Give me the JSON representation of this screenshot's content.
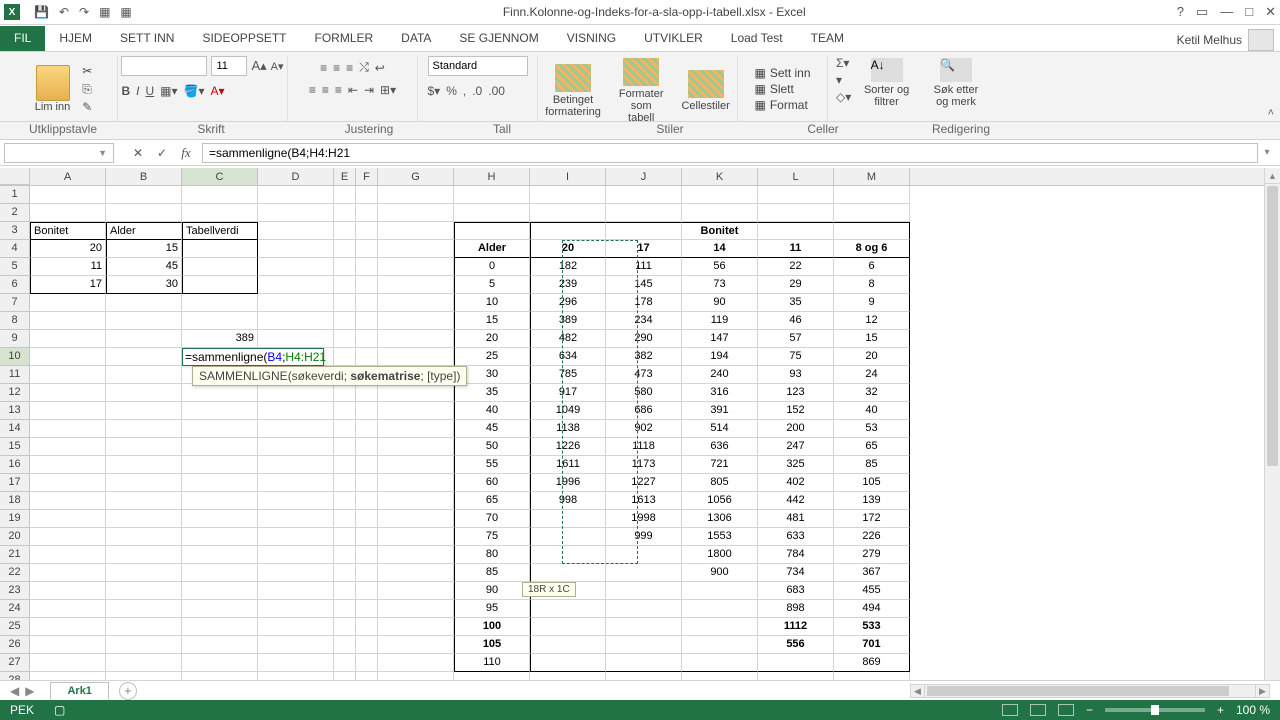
{
  "title": "Finn.Kolonne-og-Indeks-for-a-sla-opp-i-tabell.xlsx - Excel",
  "user": "Ketil Melhus",
  "tabs": [
    "FIL",
    "HJEM",
    "SETT INN",
    "SIDEOPPSETT",
    "FORMLER",
    "DATA",
    "SE GJENNOM",
    "VISNING",
    "UTVIKLER",
    "Load Test",
    "TEAM"
  ],
  "active_tab_index": 0,
  "ribbon": {
    "clipboard": {
      "label": "Utklippstavle",
      "paste": "Lim inn"
    },
    "font": {
      "label": "Skrift",
      "name": "",
      "size": "11"
    },
    "align": {
      "label": "Justering"
    },
    "number": {
      "label": "Tall",
      "format": "Standard"
    },
    "styles": {
      "label": "Stiler",
      "cond": "Betinget formatering",
      "table": "Formater som tabell",
      "cell": "Cellestiler"
    },
    "cells": {
      "label": "Celler",
      "insert": "Sett inn",
      "delete": "Slett",
      "format": "Format"
    },
    "editing": {
      "label": "Redigering",
      "sort": "Sorter og filtrer",
      "find": "Søk etter og merk"
    }
  },
  "name_box": "",
  "formula": "=sammenligne(B4;H4:H21",
  "cols": [
    "A",
    "B",
    "C",
    "D",
    "E",
    "F",
    "G",
    "H",
    "I",
    "J",
    "K",
    "L",
    "M"
  ],
  "left_table": {
    "h": [
      "Bonitet",
      "Alder",
      "Tabellverdi"
    ],
    "rows": [
      [
        "20",
        "15",
        ""
      ],
      [
        "11",
        "45",
        ""
      ],
      [
        "17",
        "30",
        ""
      ]
    ]
  },
  "c9": "389",
  "edit_text": {
    "fn": "=sammenligne(",
    "a1": "B4",
    "sep": ";",
    "a2": "H4:H21"
  },
  "tooltip": {
    "fn": "SAMMENLIGNE",
    "sig": "(søkeverdi; ",
    "cur": "søkematrise",
    "rest": "; [type])"
  },
  "size_tip": "18R x 1C",
  "bonitet_header": "Bonitet",
  "alder_header": "Alder",
  "bonitet_cols": [
    "20",
    "17",
    "14",
    "11",
    "8 og 6"
  ],
  "data_rows": [
    [
      "0",
      "182",
      "111",
      "56",
      "22",
      "6"
    ],
    [
      "5",
      "239",
      "145",
      "73",
      "29",
      "8"
    ],
    [
      "10",
      "296",
      "178",
      "90",
      "35",
      "9"
    ],
    [
      "15",
      "389",
      "234",
      "119",
      "46",
      "12"
    ],
    [
      "20",
      "482",
      "290",
      "147",
      "57",
      "15"
    ],
    [
      "25",
      "634",
      "382",
      "194",
      "75",
      "20"
    ],
    [
      "30",
      "785",
      "473",
      "240",
      "93",
      "24"
    ],
    [
      "35",
      "917",
      "580",
      "316",
      "123",
      "32"
    ],
    [
      "40",
      "1049",
      "686",
      "391",
      "152",
      "40"
    ],
    [
      "45",
      "1138",
      "902",
      "514",
      "200",
      "53"
    ],
    [
      "50",
      "1226",
      "1118",
      "636",
      "247",
      "65"
    ],
    [
      "55",
      "1611",
      "1173",
      "721",
      "325",
      "85"
    ],
    [
      "60",
      "1996",
      "1227",
      "805",
      "402",
      "105"
    ],
    [
      "65",
      "998",
      "1613",
      "1056",
      "442",
      "139"
    ],
    [
      "70",
      "",
      "1998",
      "1306",
      "481",
      "172"
    ],
    [
      "75",
      "",
      "999",
      "1553",
      "633",
      "226"
    ],
    [
      "80",
      "",
      "",
      "1800",
      "784",
      "279"
    ],
    [
      "85",
      "",
      "",
      "900",
      "734",
      "367"
    ],
    [
      "90",
      "",
      "",
      "",
      "683",
      "455"
    ],
    [
      "95",
      "",
      "",
      "",
      "898",
      "494"
    ],
    [
      "100",
      "",
      "",
      "",
      "1112",
      "533"
    ],
    [
      "105",
      "",
      "",
      "",
      "556",
      "701"
    ],
    [
      "110",
      "",
      "",
      "",
      "",
      "869"
    ]
  ],
  "bold_row_idx": [
    20,
    21
  ],
  "sheet": "Ark1",
  "mode": "PEK",
  "zoom": "100 %"
}
